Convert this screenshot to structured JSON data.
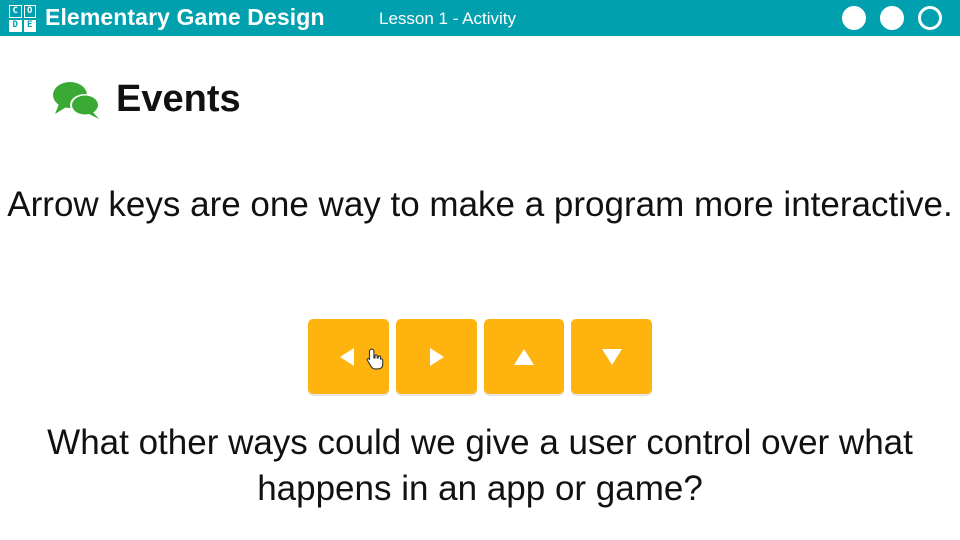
{
  "header": {
    "logo_letters": [
      "C",
      "O",
      "D",
      "E"
    ],
    "course_title": "Elementary Game Design",
    "lesson_label": "Lesson 1 - Activity",
    "background_color": "#00a0ae",
    "progress_dots": [
      "filled",
      "filled",
      "outline"
    ]
  },
  "section": {
    "icon": "speech-bubbles-icon",
    "icon_color": "#3aaa35",
    "title": "Events"
  },
  "statement": "Arrow keys are one way to make a program more interactive.",
  "arrow_keys": {
    "color": "#ffb30f",
    "keys": [
      {
        "direction": "left",
        "icon": "left-arrow-icon"
      },
      {
        "direction": "right",
        "icon": "right-arrow-icon"
      },
      {
        "direction": "up",
        "icon": "up-arrow-icon"
      },
      {
        "direction": "down",
        "icon": "down-arrow-icon"
      }
    ],
    "cursor_icon": "hand-pointer-icon"
  },
  "question": "What other ways could we give a user control over what happens in an app or game?"
}
